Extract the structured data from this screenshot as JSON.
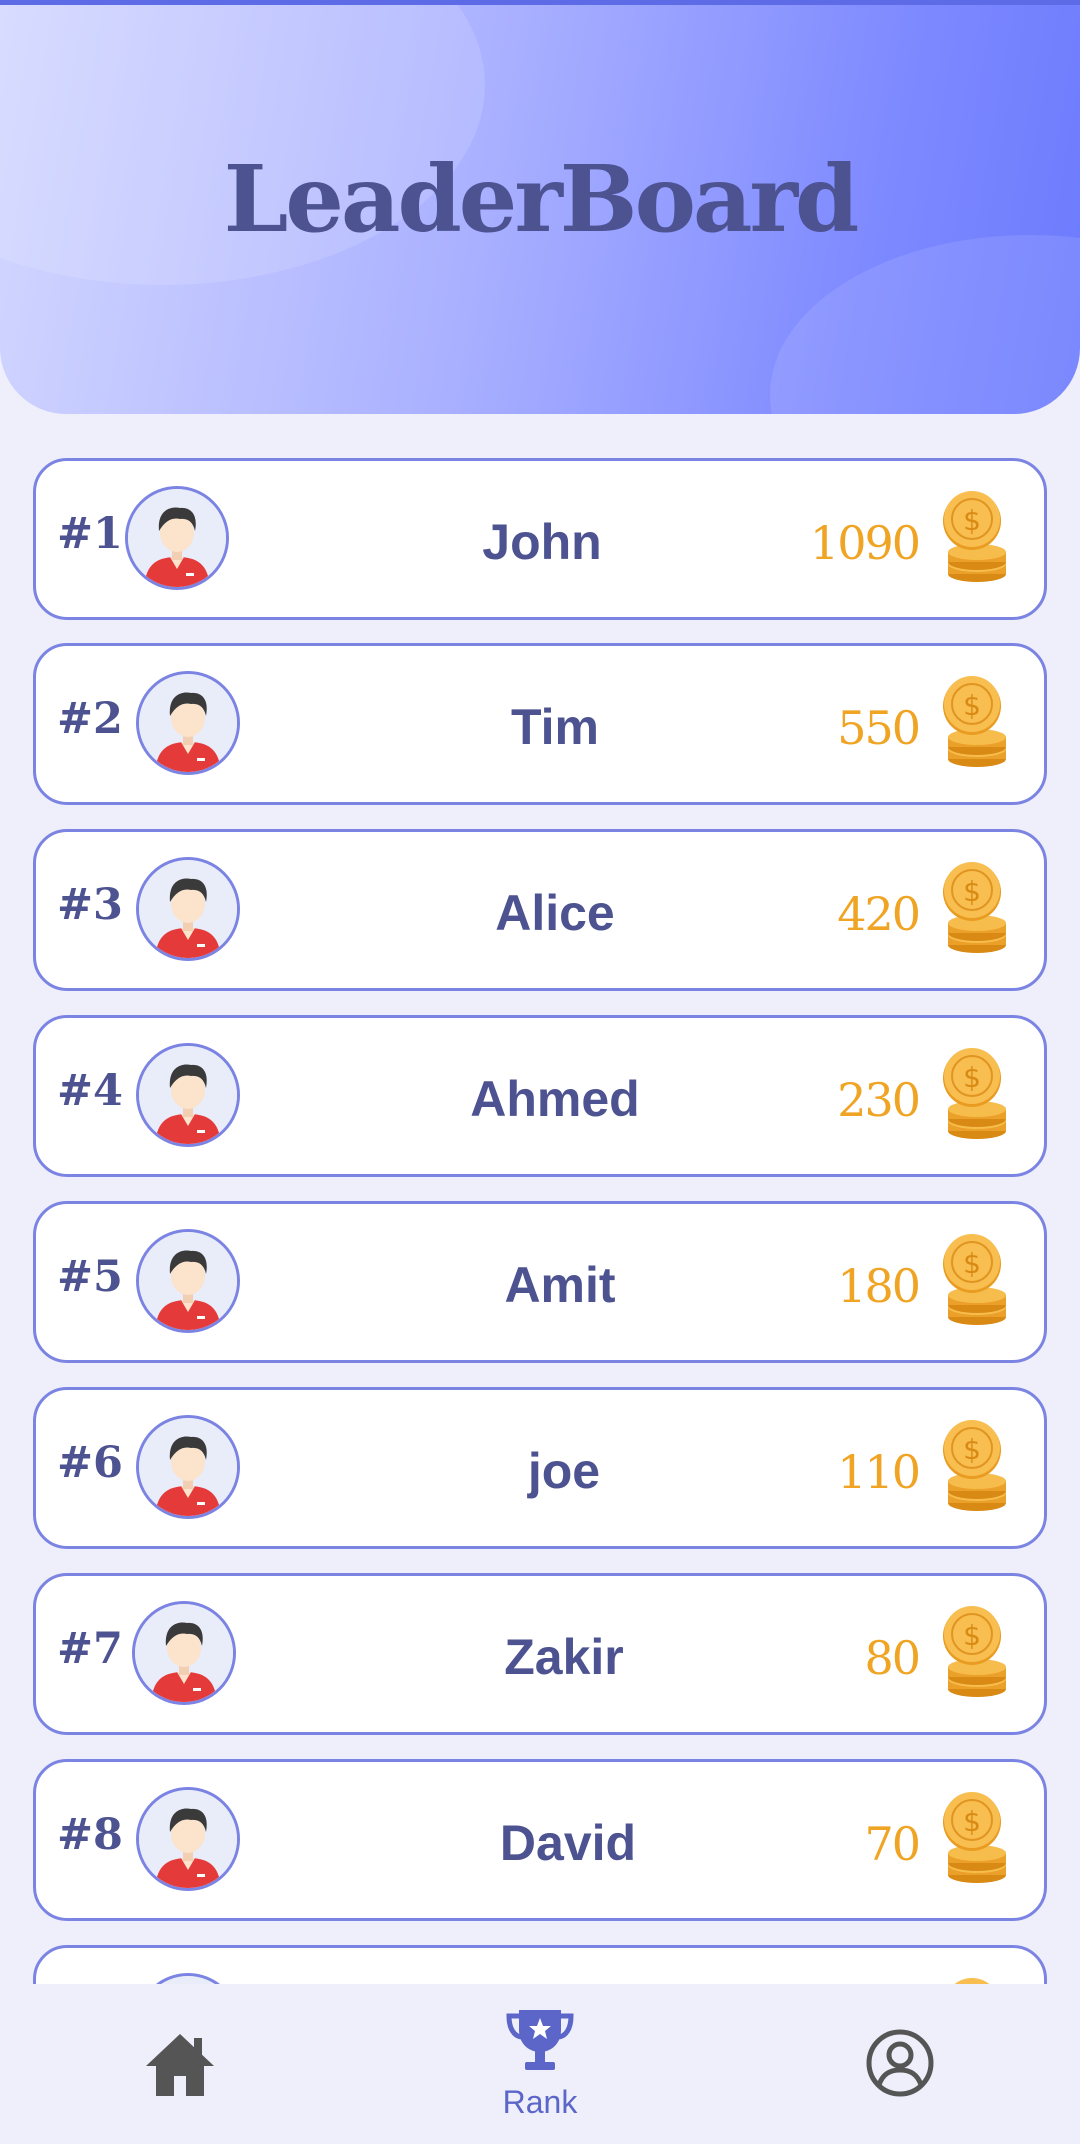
{
  "header": {
    "title": "LeaderBoard"
  },
  "leaderboard": {
    "entries": [
      {
        "rank": "#1",
        "name": "John",
        "score": "1090"
      },
      {
        "rank": "#2",
        "name": "Tim",
        "score": "550"
      },
      {
        "rank": "#3",
        "name": "Alice",
        "score": "420"
      },
      {
        "rank": "#4",
        "name": "Ahmed",
        "score": "230"
      },
      {
        "rank": "#5",
        "name": "Amit",
        "score": "180"
      },
      {
        "rank": "#6",
        "name": "joe",
        "score": "110"
      },
      {
        "rank": "#7",
        "name": "Zakir",
        "score": "80"
      },
      {
        "rank": "#8",
        "name": "David",
        "score": "70"
      }
    ]
  },
  "bottom_nav": {
    "items": [
      {
        "icon": "home-icon",
        "label": ""
      },
      {
        "icon": "trophy-icon",
        "label": "Rank"
      },
      {
        "icon": "profile-icon",
        "label": ""
      }
    ]
  },
  "colors": {
    "primary_text": "#4d5291",
    "accent": "#7b83e3",
    "score": "#f0a424",
    "nav_active": "#5b66c8"
  }
}
